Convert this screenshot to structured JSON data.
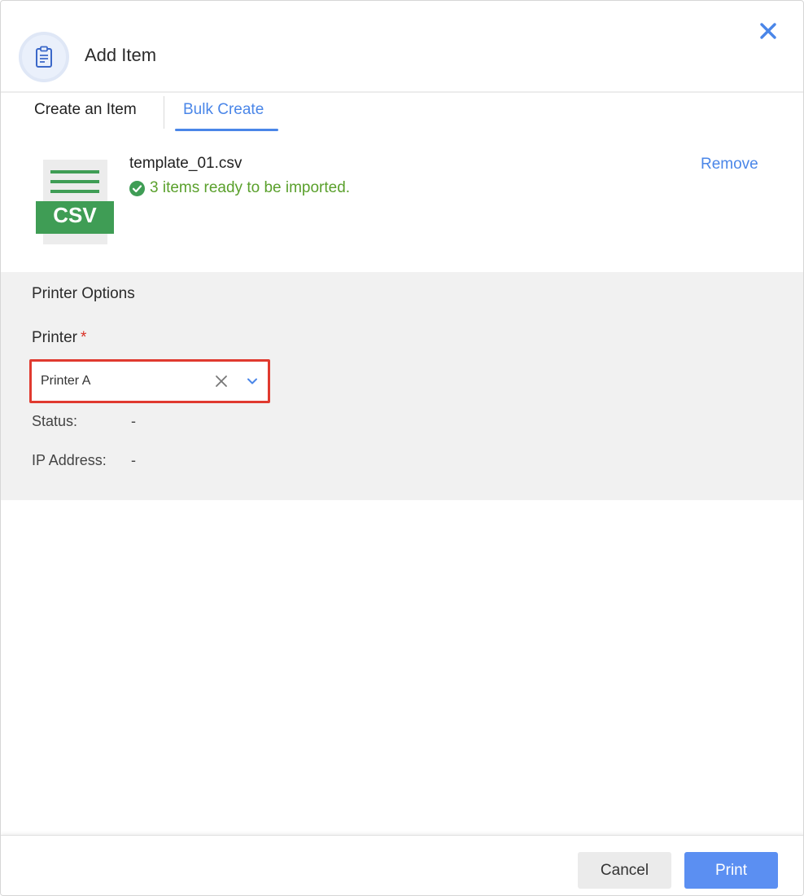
{
  "header": {
    "title": "Add Item",
    "icon": "clipboard-icon",
    "close_icon": "close-icon"
  },
  "tabs": [
    {
      "label": "Create an Item",
      "active": false
    },
    {
      "label": "Bulk Create",
      "active": true
    }
  ],
  "file": {
    "icon": "csv-file-icon",
    "icon_label": "CSV",
    "name": "template_01.csv",
    "status_icon": "check-circle-icon",
    "status_text": "3 items ready to be imported.",
    "remove_label": "Remove"
  },
  "printer_options": {
    "title": "Printer Options",
    "printer_label": "Printer",
    "required_mark": "*",
    "selected_printer": "Printer A",
    "status_label": "Status:",
    "status_value": "-",
    "ip_label": "IP Address:",
    "ip_value": "-"
  },
  "footer": {
    "cancel_label": "Cancel",
    "print_label": "Print"
  },
  "colors": {
    "accent": "#4a86e8",
    "success": "#5aa02c",
    "csv_green": "#3f9d55",
    "highlight": "#e03a2f",
    "print_button": "#5b8ff2"
  }
}
